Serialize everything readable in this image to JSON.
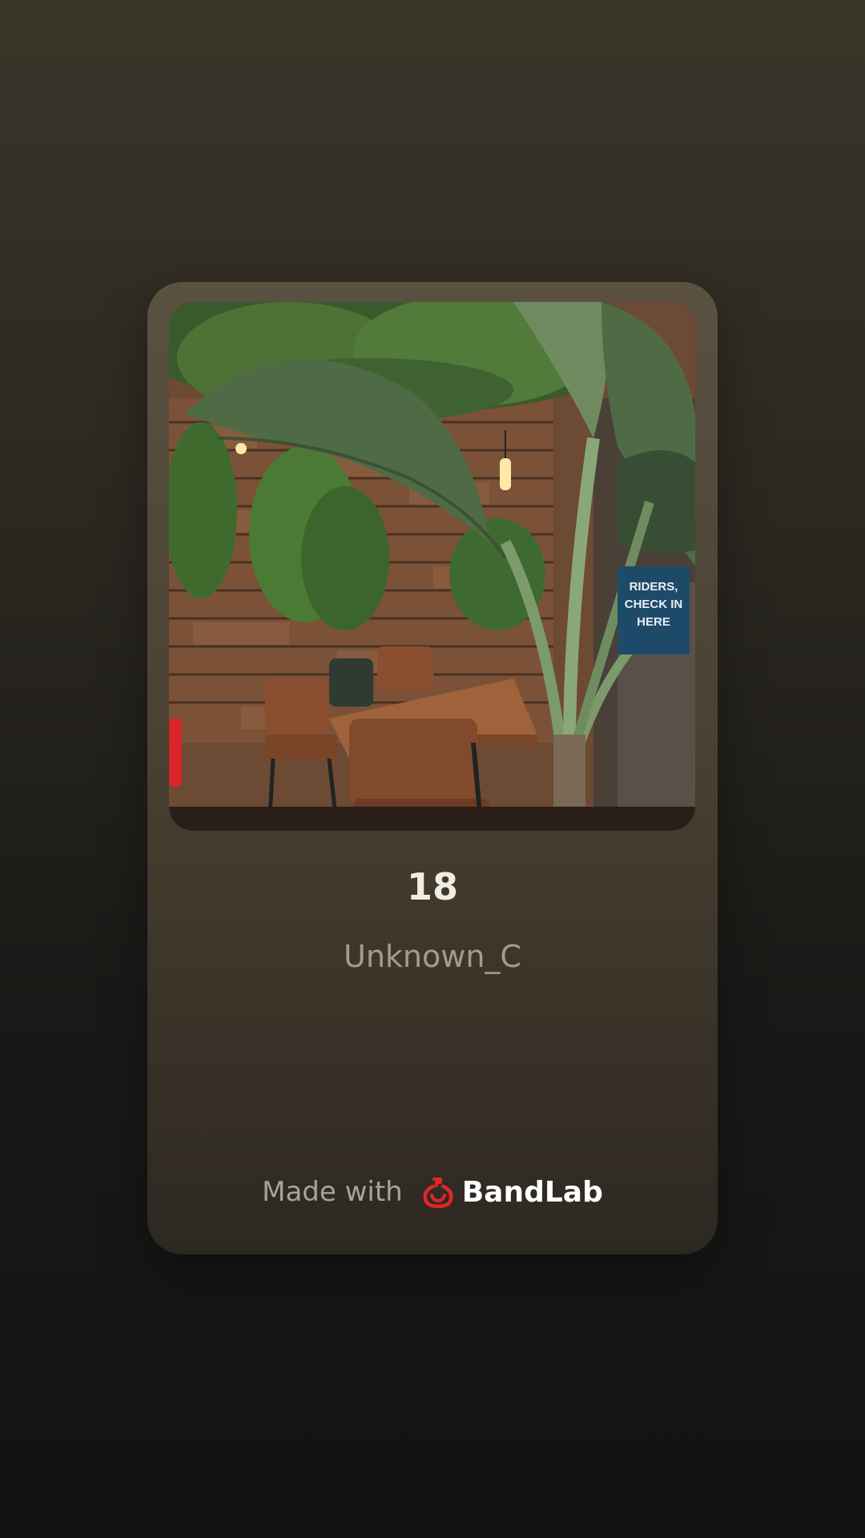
{
  "track": {
    "title": "18",
    "artist": "Unknown_C",
    "cover_alt": "Restaurant interior with plants"
  },
  "cover_sign": {
    "line1": "RIDERS,",
    "line2": "CHECK IN",
    "line3": "HERE"
  },
  "footer": {
    "made_with": "Made with",
    "brand": "BandLab",
    "brand_icon": "bandlab-logo-icon"
  },
  "colors": {
    "brand_red": "#e0262b",
    "card_top": "#5b5140",
    "card_bottom": "#2d2822"
  }
}
